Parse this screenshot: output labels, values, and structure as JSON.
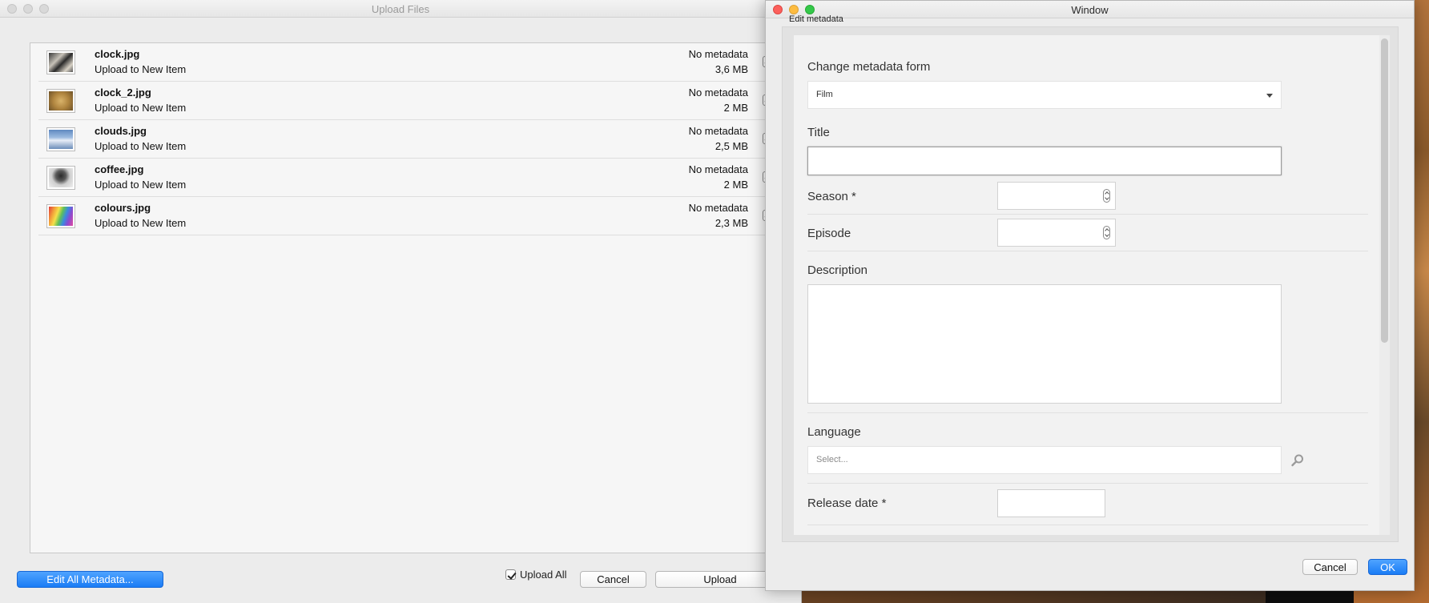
{
  "upload_window": {
    "title": "Upload Files",
    "files": [
      {
        "name": "clock.jpg",
        "destination": "Upload to New Item",
        "metadata": "No metadata",
        "size": "3,6 MB",
        "checked": true
      },
      {
        "name": "clock_2.jpg",
        "destination": "Upload to New Item",
        "metadata": "No metadata",
        "size": "2 MB",
        "checked": true
      },
      {
        "name": "clouds.jpg",
        "destination": "Upload to New Item",
        "metadata": "No metadata",
        "size": "2,5 MB",
        "checked": true
      },
      {
        "name": "coffee.jpg",
        "destination": "Upload to New Item",
        "metadata": "No metadata",
        "size": "2 MB",
        "checked": true
      },
      {
        "name": "colours.jpg",
        "destination": "Upload to New Item",
        "metadata": "No metadata",
        "size": "2,3 MB",
        "checked": true
      }
    ],
    "buttons": {
      "edit_all": "Edit All Metadata...",
      "upload_all": "Upload All",
      "cancel": "Cancel",
      "upload": "Upload"
    }
  },
  "metadata_window": {
    "title": "Window",
    "header": "Edit metadata",
    "form": {
      "change_form_label": "Change metadata form",
      "change_form_value": "Film",
      "title_label": "Title",
      "title_value": "",
      "season_label": "Season *",
      "episode_label": "Episode",
      "description_label": "Description",
      "language_label": "Language",
      "language_placeholder": "Select...",
      "release_date_label": "Release date *"
    },
    "buttons": {
      "cancel": "Cancel",
      "ok": "OK"
    }
  }
}
